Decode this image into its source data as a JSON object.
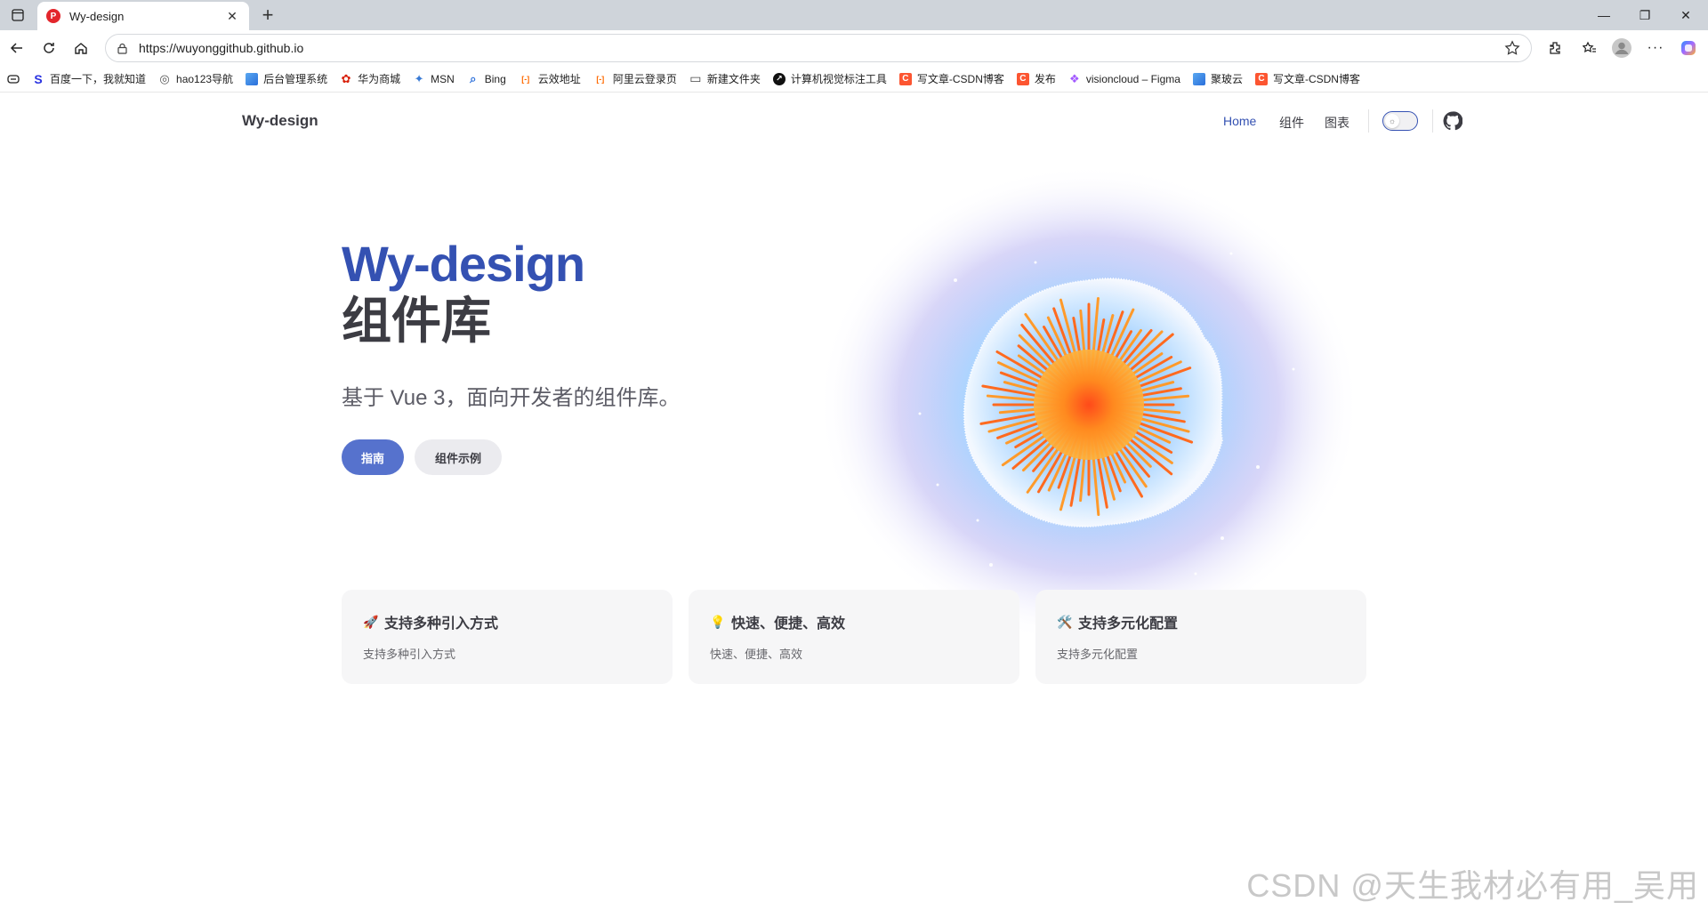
{
  "browser": {
    "tab_title": "Wy-design",
    "tab_favicon": "P",
    "url": "https://wuyonggithub.github.io",
    "window_controls": [
      "minimize",
      "restore",
      "close"
    ]
  },
  "bookmarks": [
    {
      "label": "百度一下，我就知道",
      "icon": "S",
      "color": "#2932e1"
    },
    {
      "label": "hao123导航",
      "icon": "◎",
      "color": "#888888"
    },
    {
      "label": "后台管理系统",
      "icon": "",
      "color": "#3d8ee0"
    },
    {
      "label": "华为商城",
      "icon": "✿",
      "color": "#d81e06"
    },
    {
      "label": "MSN",
      "icon": "✦",
      "color": "#3a7bd5"
    },
    {
      "label": "Bing",
      "icon": "⌕",
      "color": "#2a6fdb"
    },
    {
      "label": "云效地址",
      "icon": "[-]",
      "color": "#ff6a00"
    },
    {
      "label": "阿里云登录页",
      "icon": "[-]",
      "color": "#ff6a00"
    },
    {
      "label": "新建文件夹",
      "icon": "▭",
      "color": "#555555"
    },
    {
      "label": "计算机视觉标注工具",
      "icon": "↗",
      "color": "#111111"
    },
    {
      "label": "写文章-CSDN博客",
      "icon": "C",
      "color": "#fc5531"
    },
    {
      "label": "发布",
      "icon": "C",
      "color": "#fc5531"
    },
    {
      "label": "visioncloud – Figma",
      "icon": "❖",
      "color": "#a259ff"
    },
    {
      "label": "聚玻云",
      "icon": "",
      "color": "#3d8ee0"
    },
    {
      "label": "写文章-CSDN博客",
      "icon": "C",
      "color": "#fc5531"
    }
  ],
  "nav": {
    "brand": "Wy-design",
    "links": [
      "Home",
      "组件",
      "图表"
    ],
    "active": "Home"
  },
  "hero": {
    "name": "Wy-design",
    "text": "组件库",
    "tagline": "基于 Vue 3，面向开发者的组件库。",
    "actions": [
      "指南",
      "组件示例"
    ]
  },
  "features": [
    {
      "icon": "🚀",
      "title": "支持多种引入方式",
      "details": "支持多种引入方式"
    },
    {
      "icon": "💡",
      "title": "快速、便捷、高效",
      "details": "快速、便捷、高效"
    },
    {
      "icon": "🛠️",
      "title": "支持多元化配置",
      "details": "支持多元化配置"
    }
  ],
  "watermark": "CSDN @天生我材必有用_吴用",
  "colors": {
    "brand": "#3451b2",
    "primary_button": "#5672cd",
    "hero_glow": "#8fc6ff",
    "hero_core": "#ff8a1f"
  }
}
